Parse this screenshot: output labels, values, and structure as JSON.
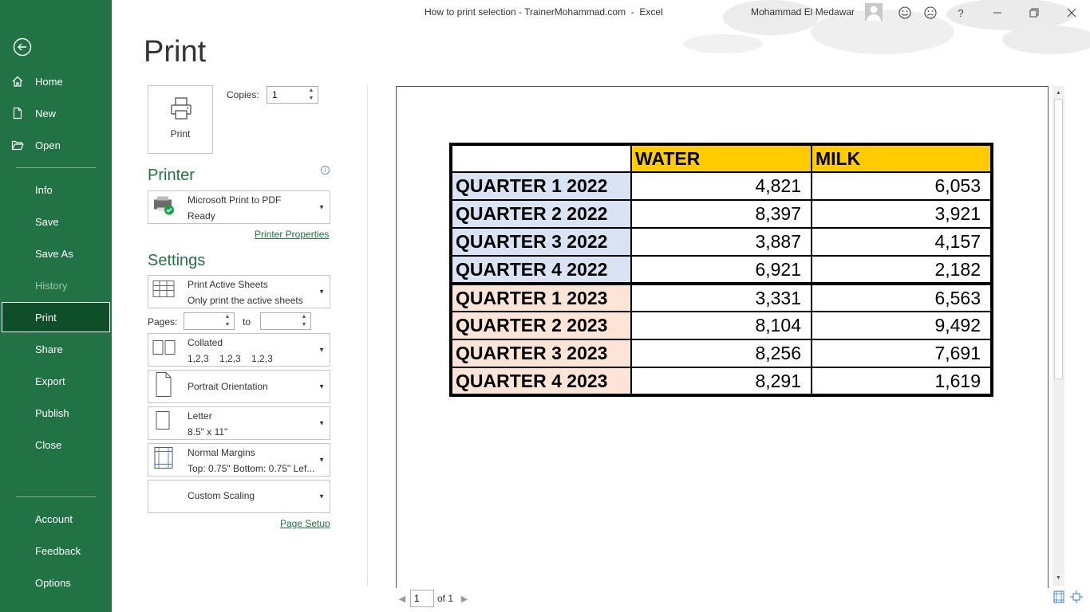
{
  "window": {
    "title": "How to print selection - TrainerMohammad.com  -  Excel",
    "user": "Mohammad El Medawar",
    "icons": [
      "smile-icon",
      "frown-icon",
      "help-icon",
      "minimize-icon",
      "restore-icon",
      "close-icon"
    ],
    "help_glyph": "?"
  },
  "sidebar": {
    "back_icon": "back-arrow-icon",
    "items": [
      {
        "label": "Home",
        "icon": "home-icon"
      },
      {
        "label": "New",
        "icon": "new-document-icon"
      },
      {
        "label": "Open",
        "icon": "open-folder-icon"
      },
      {
        "label": "Info"
      },
      {
        "label": "Save"
      },
      {
        "label": "Save As"
      },
      {
        "label": "History"
      },
      {
        "label": "Print"
      },
      {
        "label": "Share"
      },
      {
        "label": "Export"
      },
      {
        "label": "Publish"
      },
      {
        "label": "Close"
      },
      {
        "label": "Account"
      },
      {
        "label": "Feedback"
      },
      {
        "label": "Options"
      }
    ]
  },
  "print": {
    "heading": "Print",
    "print_button": "Print",
    "copies_label": "Copies:",
    "copies_value": "1",
    "printer_section": "Printer",
    "printer_name": "Microsoft Print to PDF",
    "printer_status": "Ready",
    "printer_properties": "Printer Properties",
    "settings_section": "Settings",
    "settings": {
      "what": {
        "line1": "Print Active Sheets",
        "line2": "Only print the active sheets"
      },
      "pages_label": "Pages:",
      "to_label": "to",
      "collate": {
        "line1": "Collated",
        "line2": "1,2,3    1,2,3    1,2,3"
      },
      "orientation": {
        "line1": "Portrait Orientation"
      },
      "paper": {
        "line1": "Letter",
        "line2": "8.5\" x 11\""
      },
      "margins": {
        "line1": "Normal Margins",
        "line2": "Top: 0.75\" Bottom: 0.75\" Lef..."
      },
      "scaling": {
        "line1": "Custom Scaling"
      }
    },
    "page_setup": "Page Setup"
  },
  "preview": {
    "headers": [
      "",
      "WATER",
      "MILK"
    ],
    "rows": [
      {
        "label": "QUARTER 1 2022",
        "water": "4,821",
        "milk": "6,053"
      },
      {
        "label": "QUARTER 2 2022",
        "water": "8,397",
        "milk": "3,921"
      },
      {
        "label": "QUARTER 3 2022",
        "water": "3,887",
        "milk": "4,157"
      },
      {
        "label": "QUARTER 4 2022",
        "water": "6,921",
        "milk": "2,182"
      },
      {
        "label": "QUARTER 1 2023",
        "water": "3,331",
        "milk": "6,563"
      },
      {
        "label": "QUARTER 2 2023",
        "water": "8,104",
        "milk": "9,492"
      },
      {
        "label": "QUARTER 3 2023",
        "water": "8,256",
        "milk": "7,691"
      },
      {
        "label": "QUARTER 4 2023",
        "water": "8,291",
        "milk": "1,619"
      }
    ],
    "colors": {
      "header_fill": "#ffcc00",
      "fill_2022": "#dae3f3",
      "fill_2023": "#fce4d6"
    },
    "current_page": "1",
    "page_total": "of 1"
  },
  "theme": {
    "accent": "#217346",
    "active_nav": "#0e4f2a"
  }
}
